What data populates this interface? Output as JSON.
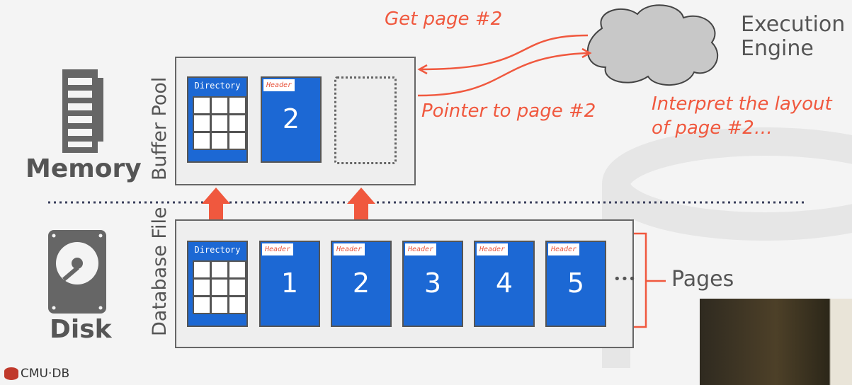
{
  "labels": {
    "memory": "Memory",
    "disk": "Disk",
    "buffer_pool": "Buffer Pool",
    "database_file": "Database File",
    "pages": "Pages",
    "ellipsis": "•••",
    "execution_engine_1": "Execution",
    "execution_engine_2": "Engine",
    "logo": "CMU·DB"
  },
  "annotations": {
    "get_page": "Get page #2",
    "pointer": "Pointer to page #2",
    "interpret_1": "Interpret the layout",
    "interpret_2": "of page #2…"
  },
  "buffer_pool": {
    "directory": "Directory",
    "page": {
      "header": "Header",
      "number": "2"
    }
  },
  "database_file": {
    "directory": "Directory",
    "pages": [
      {
        "header": "Header",
        "number": "1"
      },
      {
        "header": "Header",
        "number": "2"
      },
      {
        "header": "Header",
        "number": "3"
      },
      {
        "header": "Header",
        "number": "4"
      },
      {
        "header": "Header",
        "number": "5"
      }
    ]
  },
  "colors": {
    "page": "#1c68d4",
    "accent": "#f0583e",
    "text": "#555555"
  }
}
